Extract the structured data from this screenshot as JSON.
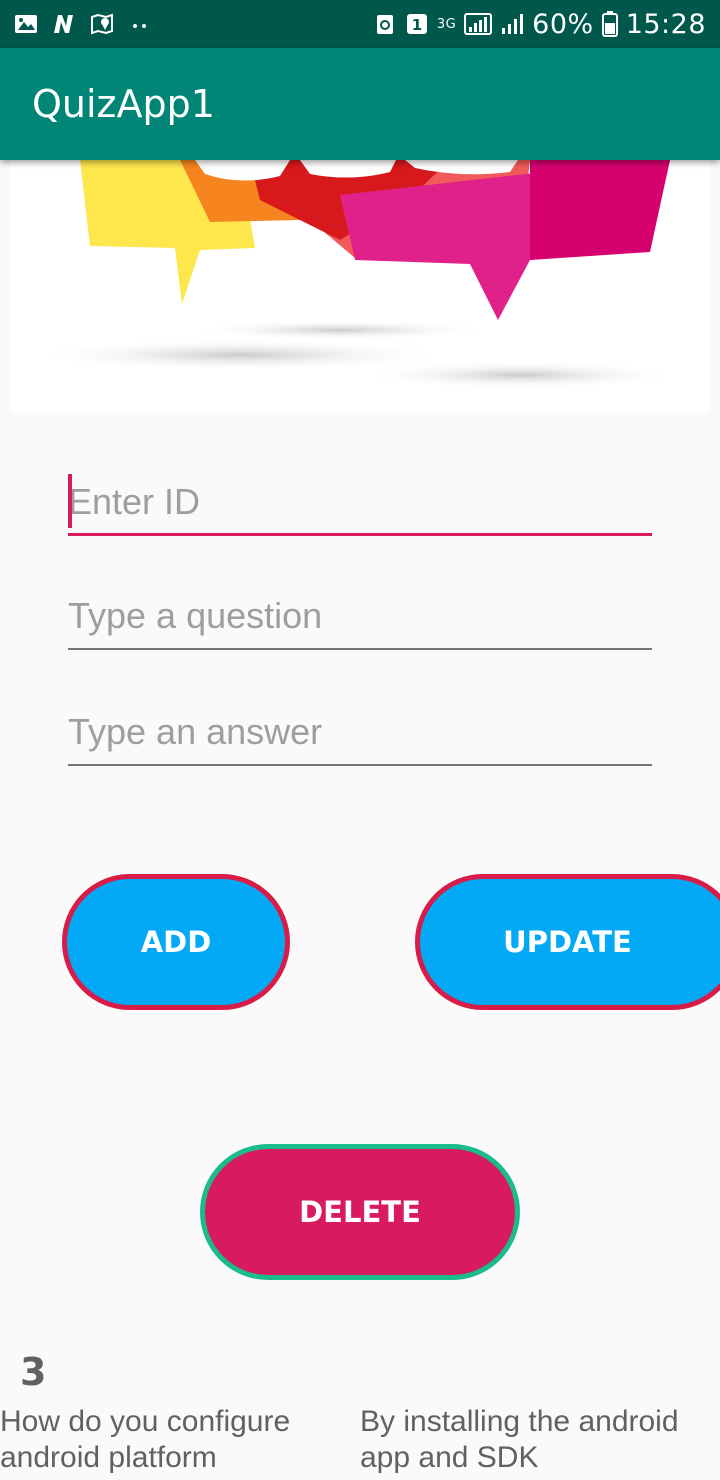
{
  "status_bar": {
    "icons": [
      "image-icon",
      "n-app-icon",
      "map-pin-icon",
      "dots-icon",
      "recycle-icon",
      "sim-1-icon",
      "3g-signal-icon",
      "signal-icon",
      "battery-icon"
    ],
    "battery": "60%",
    "time": "15:28",
    "network": "3G"
  },
  "app_bar": {
    "title": "QuizApp1"
  },
  "form": {
    "id_placeholder": "Enter ID",
    "question_placeholder": "Type a question",
    "answer_placeholder": "Type an answer"
  },
  "buttons": {
    "add": "ADD",
    "update": "UPDATE",
    "delete": "DELETE"
  },
  "quiz_item": {
    "id": "3",
    "question": "How do you configure android platform",
    "answer": "By installing the android app and SDK"
  },
  "colors": {
    "status_bar": "#00574b",
    "app_bar": "#008577",
    "accent": "#d81b60",
    "button_blue": "#03a9f4",
    "button_border_red": "#d81b47",
    "delete_border": "#1abc8c"
  }
}
